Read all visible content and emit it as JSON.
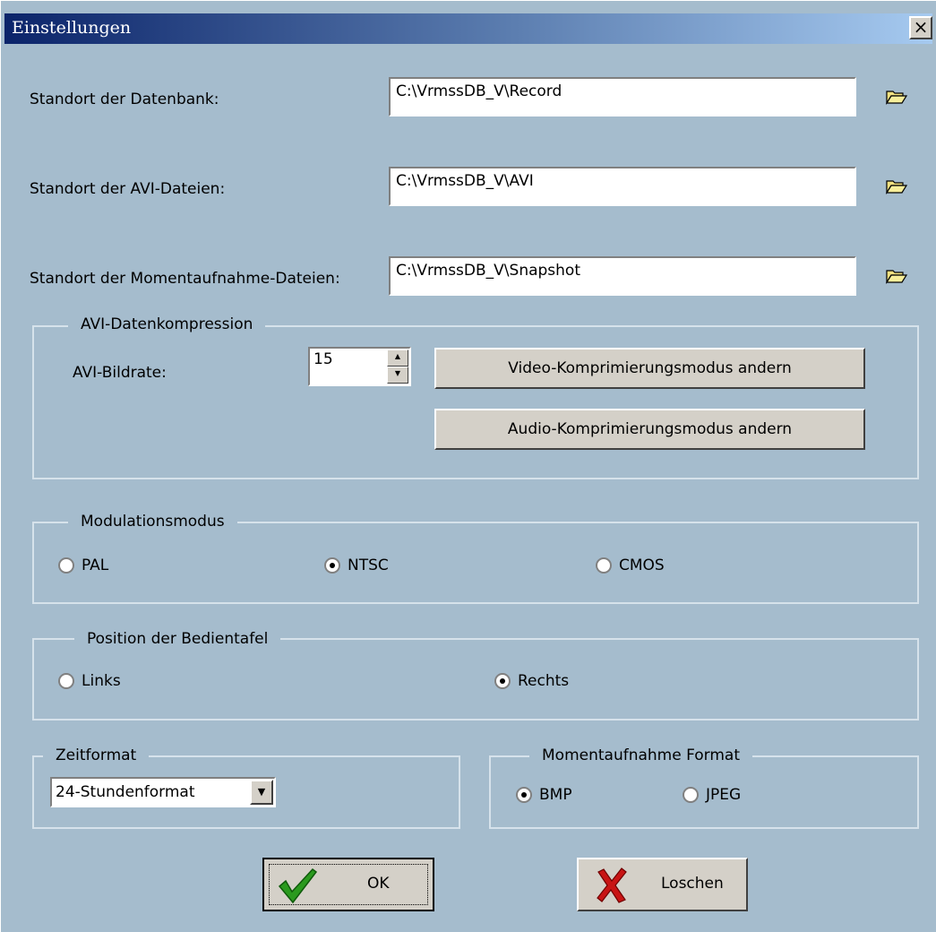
{
  "window": {
    "title": "Einstellungen",
    "close_glyph": "×"
  },
  "paths": {
    "db_label": "Standort der Datenbank:",
    "db_value": "C:\\VrmssDB_V\\Record",
    "avi_label": "Standort der AVI-Dateien:",
    "avi_value": "C:\\VrmssDB_V\\AVI",
    "snap_label": "Standort der Momentaufnahme-Dateien:",
    "snap_value": "C:\\VrmssDB_V\\Snapshot",
    "browse_icon": "folder-open-icon"
  },
  "avi": {
    "group_title": "AVI-Datenkompression",
    "framerate_label": "AVI-Bildrate:",
    "framerate_value": "15",
    "video_button": "Video-Komprimierungsmodus andern",
    "audio_button": "Audio-Komprimierungsmodus andern"
  },
  "modulation": {
    "group_title": "Modulationsmodus",
    "options": [
      "PAL",
      "NTSC",
      "CMOS"
    ],
    "selected": "NTSC"
  },
  "panel_position": {
    "group_title": "Position der Bedientafel",
    "options": [
      "Links",
      "Rechts"
    ],
    "selected": "Rechts"
  },
  "time_format": {
    "group_title": "Zeitformat",
    "selected_value": "24-Stundenformat"
  },
  "snapshot_format": {
    "group_title": "Momentaufnahme Format",
    "options": [
      "BMP",
      "JPEG"
    ],
    "selected": "BMP"
  },
  "buttons": {
    "ok": "OK",
    "cancel": "Loschen"
  },
  "colors": {
    "dialog_bg": "#a5bccd",
    "title_gradient_start": "#0b246a",
    "ok_icon": "#2a9a1e",
    "cancel_icon": "#c81414"
  }
}
